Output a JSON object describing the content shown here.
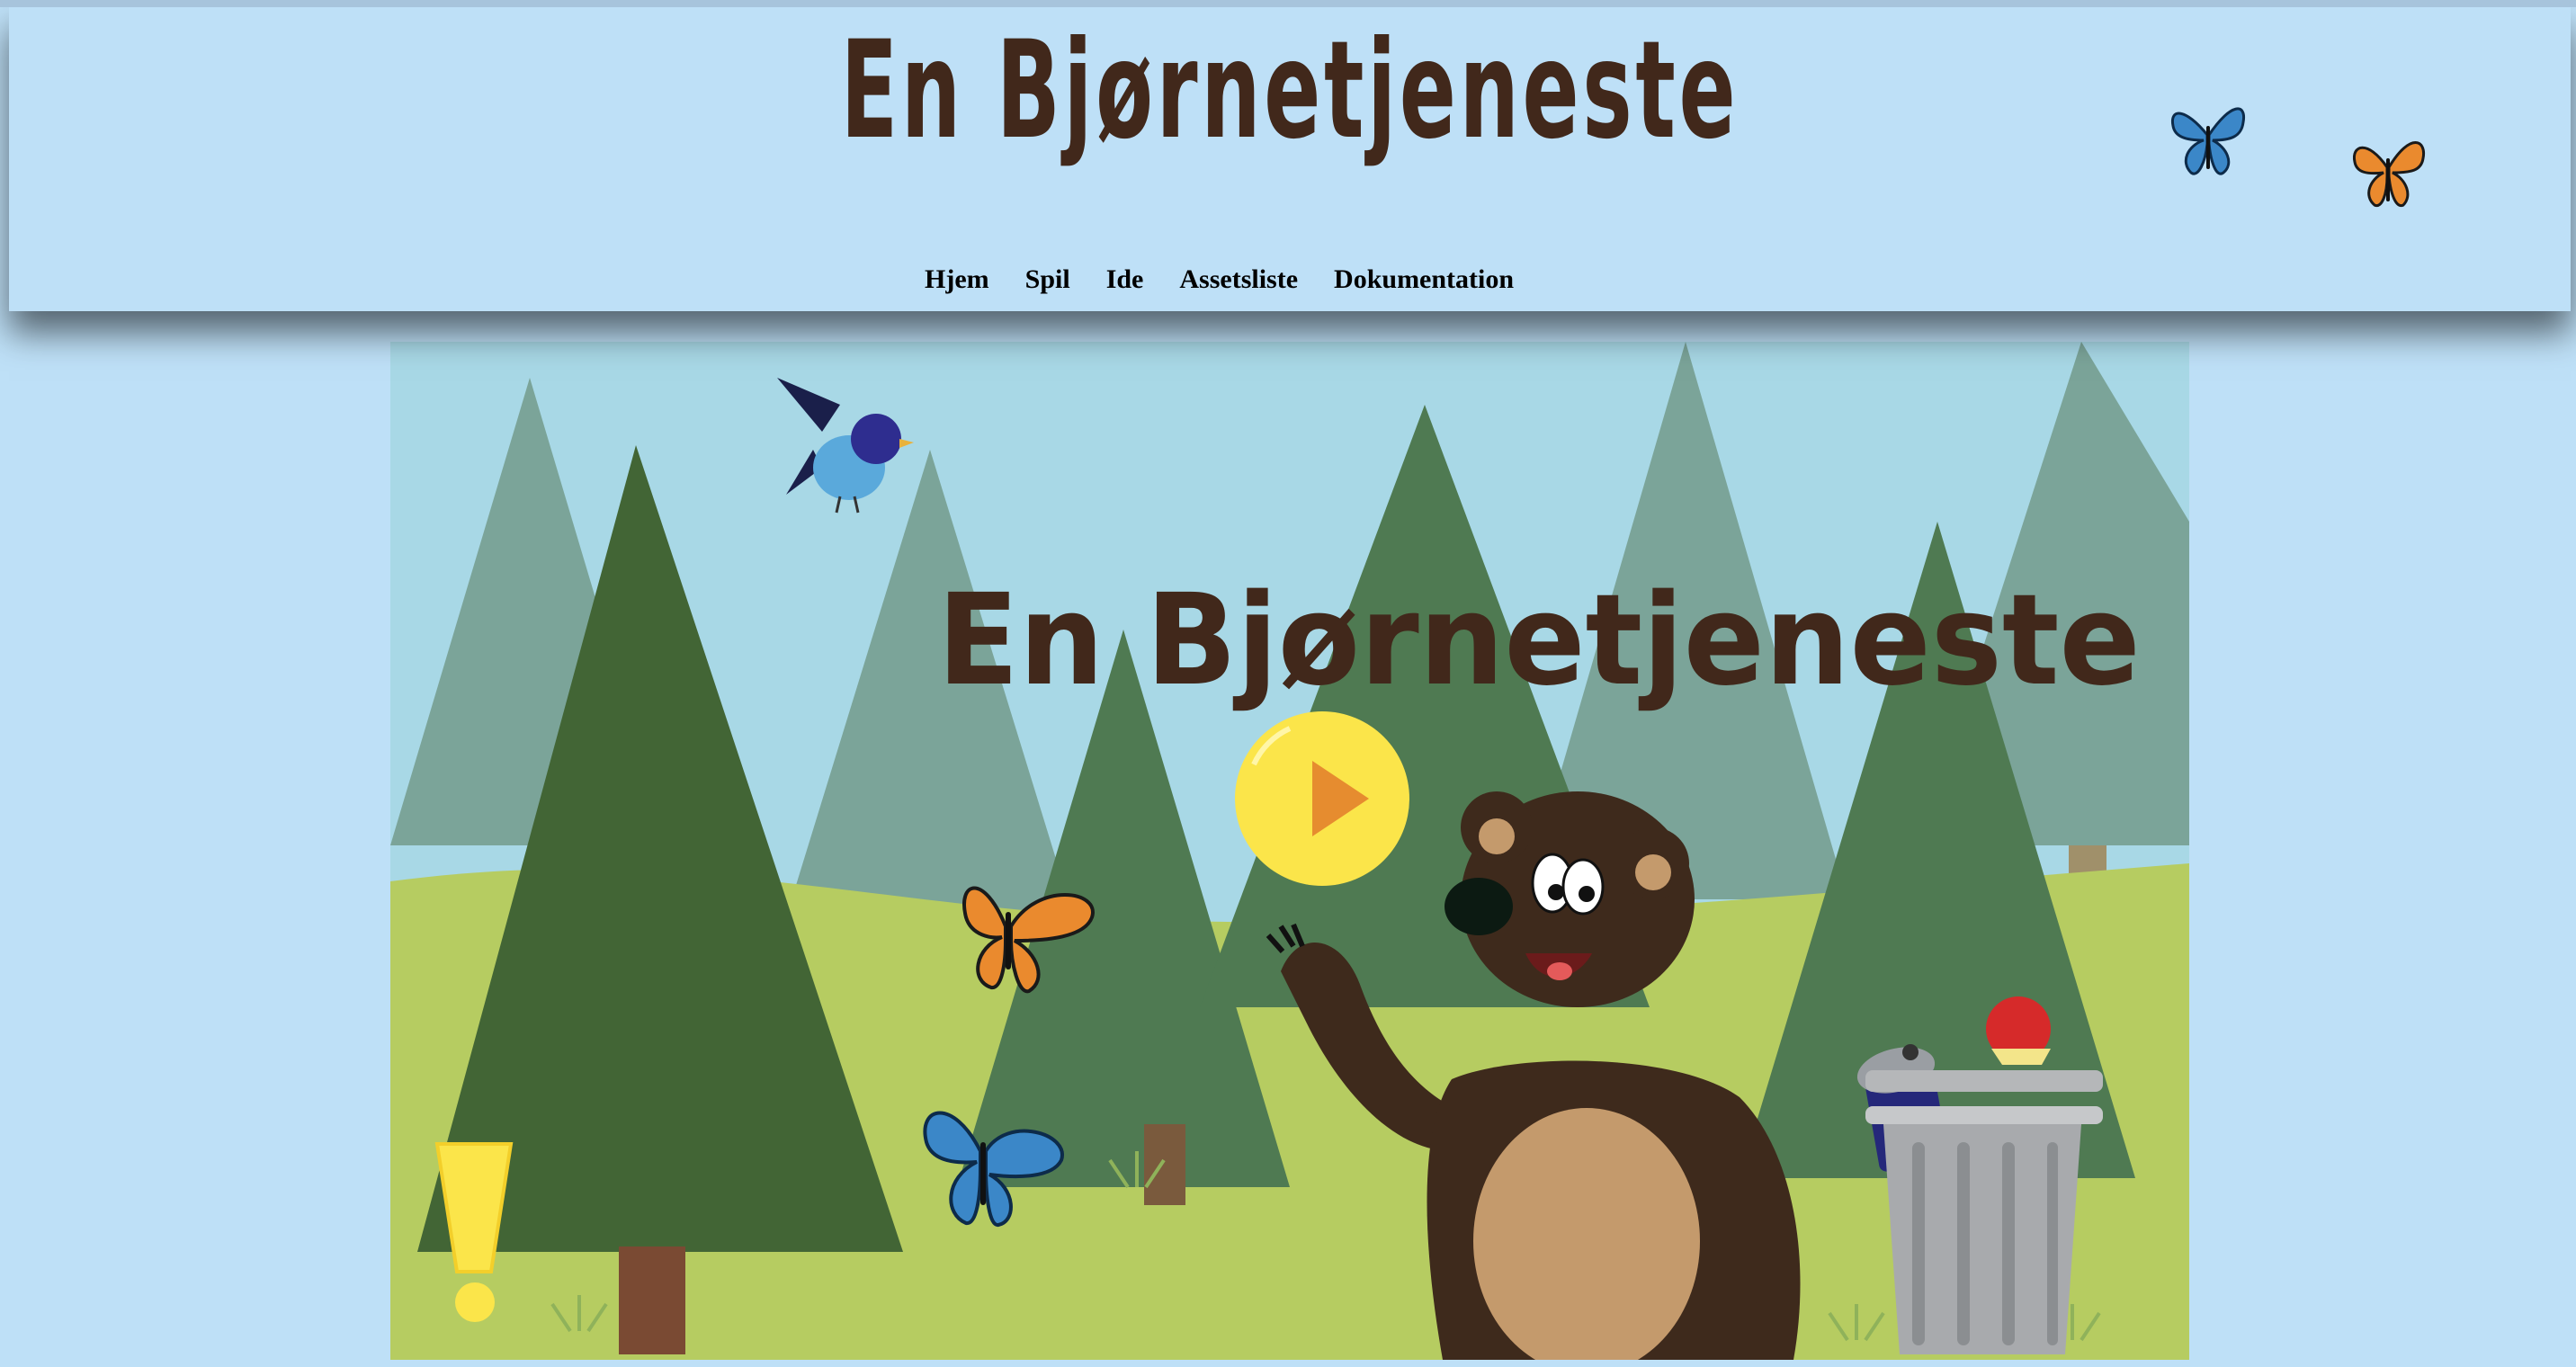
{
  "header": {
    "title": "En Bjørnetjeneste",
    "nav": [
      {
        "label": "Hjem"
      },
      {
        "label": "Spil"
      },
      {
        "label": "Ide"
      },
      {
        "label": "Assetsliste"
      },
      {
        "label": "Dokumentation"
      }
    ]
  },
  "game": {
    "title": "En Bjørnetjeneste",
    "play_icon": "play-icon",
    "hint_icon": "exclamation-icon"
  },
  "colors": {
    "background": "#bee0f7",
    "title_brown": "#41281b",
    "play_yellow": "#fbe54a",
    "play_orange": "#e68c2f"
  }
}
